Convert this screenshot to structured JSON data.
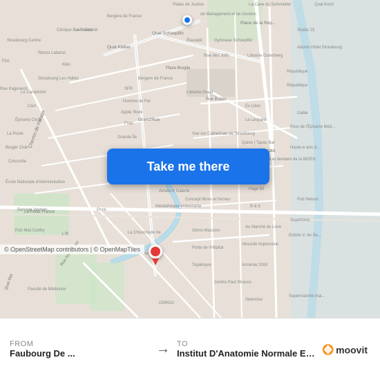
{
  "map": {
    "button_label": "Take me there",
    "origin_dot_title": "Starting point",
    "dest_pin_title": "Destination"
  },
  "bottom_bar": {
    "from_label": "From",
    "from_name": "Faubourg De ...",
    "to_label": "To",
    "to_name": "Institut D'Anatomie Normale Et Pa...",
    "arrow": "→",
    "copyright": "© OpenStreetMap contributors | © OpenMapTiles"
  },
  "moovit": {
    "logo_text": "moovit"
  }
}
